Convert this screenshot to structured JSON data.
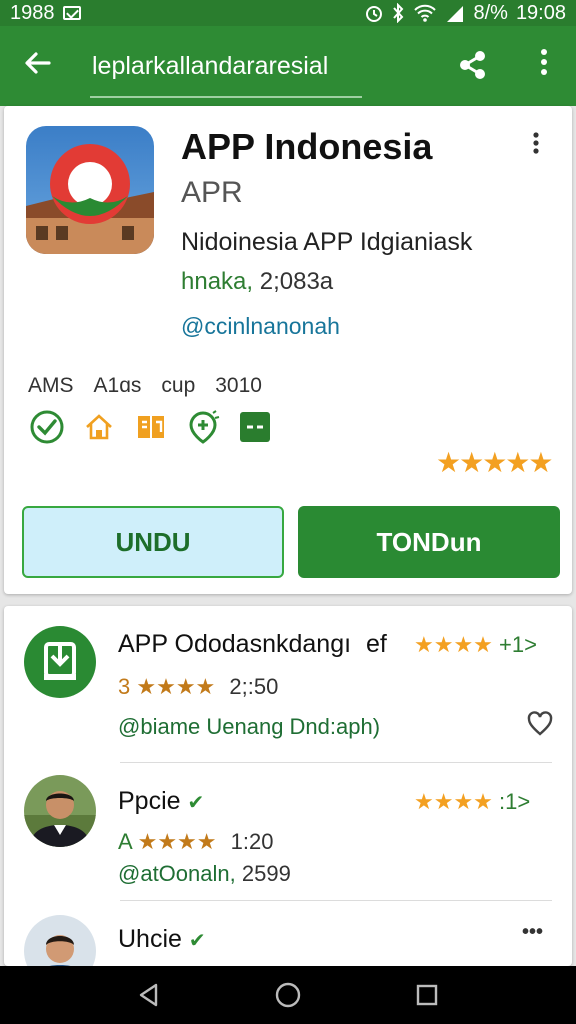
{
  "status_bar": {
    "left_time": "1988",
    "right_battery": "8/%",
    "right_time": "19:08"
  },
  "app_bar": {
    "title": "leplarkallandararesial"
  },
  "app": {
    "title": "APP Indonesia",
    "subtitle": "APR",
    "description": "Nidoinesia APP Idgianiask",
    "meta_label": "hnaka,",
    "meta_value": "2;083a",
    "developer": "@ccinlnanonah",
    "features": [
      "AMS",
      "A1ɑs",
      "cup",
      "3010"
    ],
    "rating_stars": "★★★★★",
    "button_secondary": "UNDU",
    "button_primary": "TONDun"
  },
  "list": [
    {
      "title": "APP Ododasnkdangı",
      "title_suffix": "ef",
      "stars": "★★★★",
      "count": "+1>",
      "sub_stars_prefix": "3",
      "sub_stars": "★★★★",
      "sub_value": "2;:50",
      "desc": "@biame Uenang Dnd:aph)"
    },
    {
      "title": "Ppcie",
      "stars": "★★★★",
      "count": ":1>",
      "sub_stars_prefix": "A",
      "sub_stars": "★★★★",
      "sub_value": "1:20",
      "desc": "@atOonaln,",
      "desc_value": "2599"
    },
    {
      "title": "Uhcie",
      "more": "•••"
    }
  ],
  "colors": {
    "primary": "#2e8b34",
    "status": "#2a7d2e",
    "star": "#f3a021",
    "secondary_button_bg": "#cfeffa"
  }
}
